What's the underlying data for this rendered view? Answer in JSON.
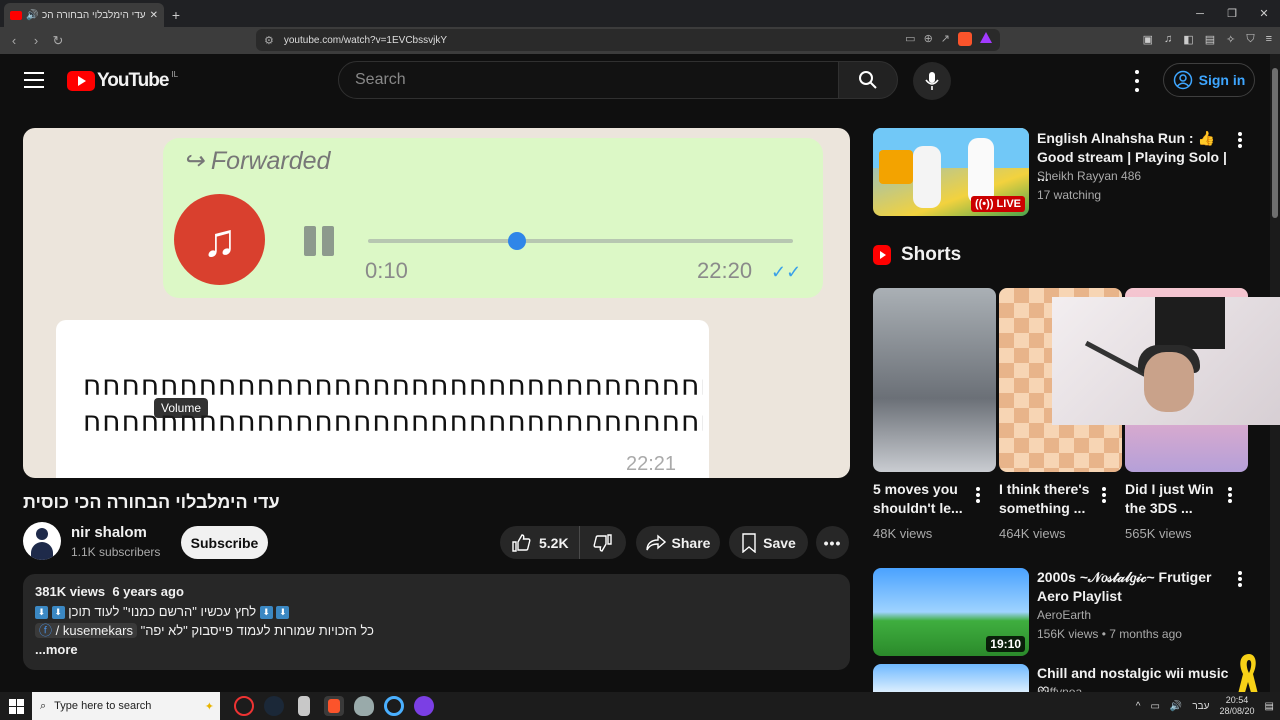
{
  "browser": {
    "tab_title": "עדי הימלבלוי הבחורה הכי כוסית - YouTube",
    "url": "youtube.com/watch?v=1EVCbssvjkY"
  },
  "header": {
    "logo_text": "YouTube",
    "country_code": "IL",
    "search_placeholder": "Search",
    "signin_label": "Sign in"
  },
  "player": {
    "forwarded_label": "Forwarded",
    "elapsed": "0:10",
    "time_sent": "22:20",
    "message_text_line1": "חחחחחחחחחחחחחחחחחחחחחחחחחחחחחחחחחחח",
    "message_text_line2": "חחחחחחחחחחחחחחחחחחחחחחחחחחחחחחחחחח",
    "time_sent_2": "22:21",
    "tooltip": "Volume",
    "progress_fraction": 0.35
  },
  "video": {
    "title": "עדי הימלבלוי הבחורה הכי כוסית",
    "channel": "nir shalom",
    "subscribers": "1.1K subscribers",
    "subscribe_label": "Subscribe",
    "likes": "5.2K",
    "share_label": "Share",
    "save_label": "Save"
  },
  "description": {
    "views": "381K views",
    "age": "6 years ago",
    "line1": "לחץ עכשיו \"הרשם כמנוי\" לעוד תוכן",
    "line2_prefix": "כל הזכויות שמורות לעמוד פייסבוק \"לא יפה\"",
    "line2_tag": "/ kusemekars",
    "more_label": "...more"
  },
  "sidebar": {
    "live_video": {
      "title": "English Alnahsha Run : 👍 Good stream | Playing Solo | ...",
      "channel": "Sheikh Rayyan 486",
      "watching": "17 watching",
      "badge": "LIVE"
    },
    "shorts_heading": "Shorts",
    "shorts": [
      {
        "title": "5 moves you shouldn't le...",
        "views": "48K views"
      },
      {
        "title": "I think there's something ...",
        "views": "464K views"
      },
      {
        "title": "Did I just Win the 3DS ...",
        "views": "565K views"
      }
    ],
    "video2": {
      "title": "2000s ~𝒩𝑜𝓈𝓉𝒶𝓁𝑔𝒾𝒸~ Frutiger Aero Playlist",
      "channel": "AeroEarth",
      "meta": "156K views • 7 months ago",
      "duration": "19:10"
    },
    "video3": {
      "title": "Chill and nostalgic wii music ♡",
      "channel": "miffynoa"
    }
  },
  "taskbar": {
    "search_placeholder": "Type here to search",
    "lang": "עבר",
    "time": "20:54",
    "date": "28/08/20"
  }
}
